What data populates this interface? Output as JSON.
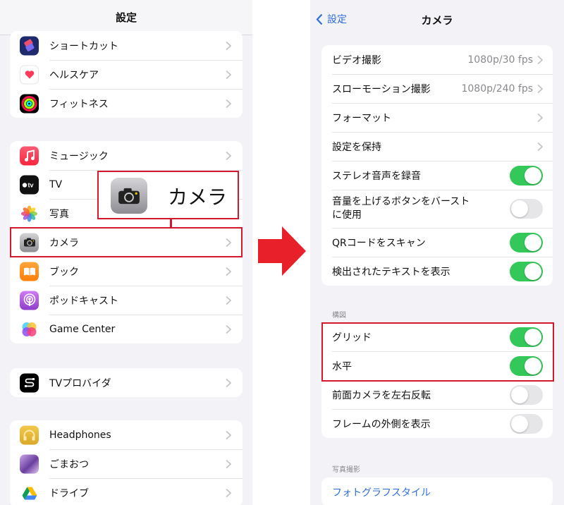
{
  "left": {
    "title": "設定",
    "groups": [
      [
        {
          "label": "ショートカット",
          "icon": "shortcuts-icon"
        },
        {
          "label": "ヘルスケア",
          "icon": "health-icon"
        },
        {
          "label": "フィットネス",
          "icon": "fitness-icon"
        }
      ],
      [
        {
          "label": "ミュージック",
          "icon": "music-icon"
        },
        {
          "label": "TV",
          "icon": "tv-icon"
        },
        {
          "label": "写真",
          "icon": "photos-icon"
        },
        {
          "label": "カメラ",
          "icon": "camera-icon",
          "highlighted": true
        },
        {
          "label": "ブック",
          "icon": "books-icon"
        },
        {
          "label": "ポッドキャスト",
          "icon": "podcasts-icon"
        },
        {
          "label": "Game Center",
          "icon": "game-center-icon"
        }
      ],
      [
        {
          "label": "TVプロバイダ",
          "icon": "tv-provider-icon"
        }
      ],
      [
        {
          "label": "Headphones",
          "icon": "headphones-icon"
        },
        {
          "label": "ごまおつ",
          "icon": "gomaotsu-icon"
        },
        {
          "label": "ドライブ",
          "icon": "google-drive-icon"
        }
      ]
    ],
    "callout": {
      "label": "カメラ",
      "icon": "camera-icon"
    }
  },
  "right": {
    "back_label": "設定",
    "title": "カメラ",
    "group1": [
      {
        "label": "ビデオ撮影",
        "value": "1080p/30 fps",
        "type": "nav"
      },
      {
        "label": "スローモーション撮影",
        "value": "1080p/240 fps",
        "type": "nav"
      },
      {
        "label": "フォーマット",
        "type": "nav"
      },
      {
        "label": "設定を保持",
        "type": "nav"
      },
      {
        "label": "ステレオ音声を録音",
        "type": "toggle",
        "on": true
      },
      {
        "label": "音量を上げるボタンをバースト\nに使用",
        "type": "toggle",
        "on": false
      },
      {
        "label": "QRコードをスキャン",
        "type": "toggle",
        "on": true
      },
      {
        "label": "検出されたテキストを表示",
        "type": "toggle",
        "on": true
      }
    ],
    "composition_header": "構図",
    "group2": [
      {
        "label": "グリッド",
        "type": "toggle",
        "on": true,
        "highlighted": true
      },
      {
        "label": "水平",
        "type": "toggle",
        "on": true,
        "highlighted": true
      },
      {
        "label": "前面カメラを左右反転",
        "type": "toggle",
        "on": false
      },
      {
        "label": "フレームの外側を表示",
        "type": "toggle",
        "on": false
      }
    ],
    "photo_header": "写真撮影",
    "group3": [
      {
        "label": "フォトグラフスタイル",
        "type": "link"
      }
    ]
  },
  "colors": {
    "highlight": "#d4182d",
    "toggle_on": "#34c759",
    "link": "#2f6fd6"
  }
}
